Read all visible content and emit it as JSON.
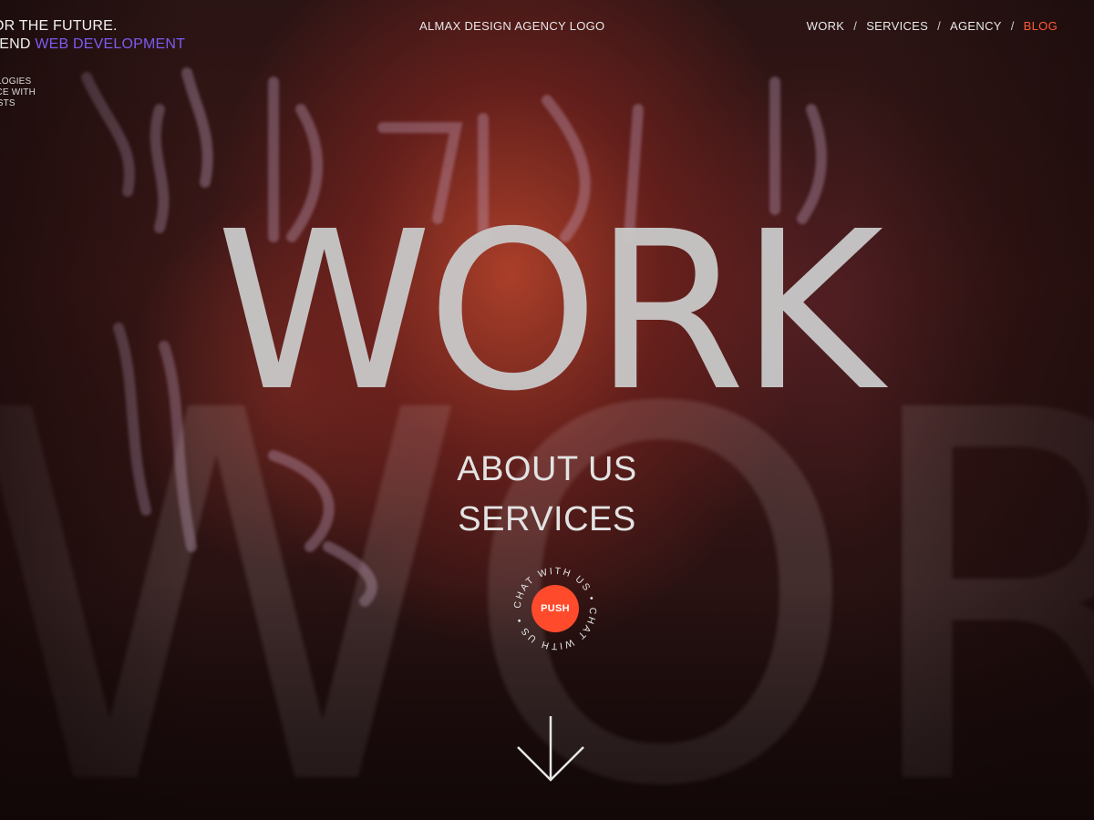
{
  "tagline": {
    "line1": "FOR THE FUTURE.",
    "line2_prefix": "D-END ",
    "line2_accent": "WEB DEVELOPMENT",
    "small1": "OLOGIES",
    "small2": "NCE WITH",
    "small3": "LISTS"
  },
  "logo": "ALMAX DESIGN AGENCY LOGO",
  "nav": {
    "items": [
      {
        "label": "WORK"
      },
      {
        "label": "SERVICES"
      },
      {
        "label": "AGENCY"
      },
      {
        "label": "BLOG"
      }
    ],
    "separator": "/",
    "active_color": "#ff5a3c"
  },
  "hero": {
    "title": "WORK",
    "ghost": "WOR"
  },
  "menu": {
    "about": "ABOUT US",
    "services": "SERVICES"
  },
  "chat": {
    "ring_text": "CHAT WITH US • CHAT WITH US •",
    "button": "PUSH",
    "button_color": "#ff4a2c"
  },
  "icons": {
    "scroll": "arrow-down-icon"
  }
}
